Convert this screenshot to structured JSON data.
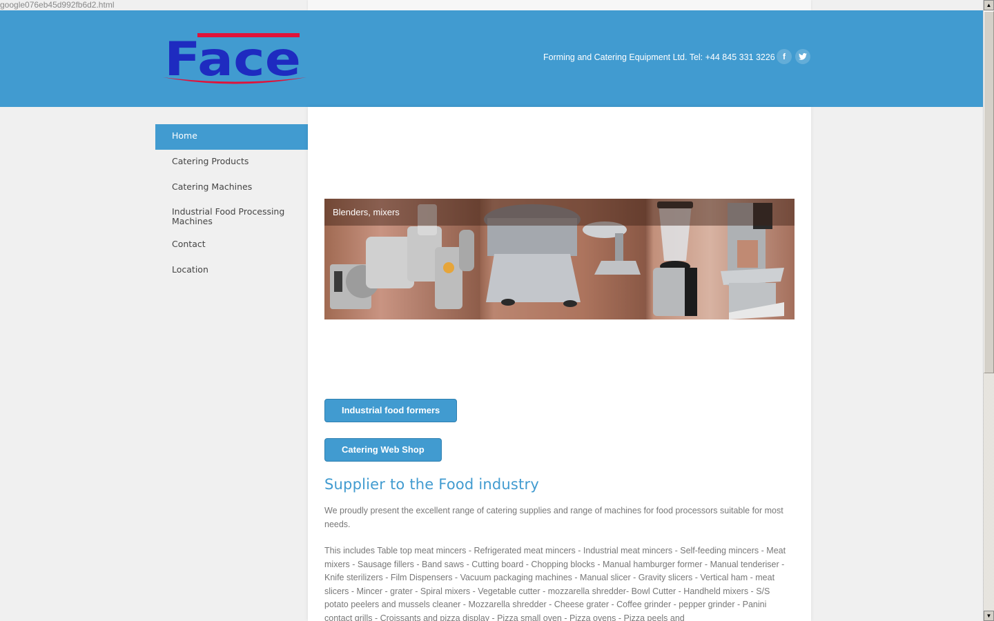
{
  "page_url": "google076eb45d992fb6d2.html",
  "header": {
    "logo_text": "Face",
    "company_info": "Forming and Catering Equipment Ltd. Tel: +44 845 331 3226",
    "social": [
      {
        "name": "facebook",
        "glyph": "f"
      },
      {
        "name": "twitter",
        "glyph": "t"
      }
    ],
    "brand_color": "#419bd0",
    "logo_blue": "#1e2bc0",
    "logo_red": "#e0123a"
  },
  "sidebar": {
    "items": [
      {
        "label": "Home",
        "active": true
      },
      {
        "label": "Catering Products",
        "active": false
      },
      {
        "label": "Catering Machines",
        "active": false
      },
      {
        "label": "Industrial Food Processing Machines",
        "active": false
      },
      {
        "label": "Contact",
        "active": false
      },
      {
        "label": "Location",
        "active": false
      }
    ]
  },
  "slider": {
    "caption": "Blenders, mixers",
    "panels": [
      "food-processors-image",
      "hamburger-former-image",
      "blender-image",
      "band-saw-image"
    ]
  },
  "buttons": {
    "industrial_food_formers": "Industrial food formers",
    "catering_web_shop": "Catering Web Shop"
  },
  "content": {
    "heading": "Supplier to the Food industry",
    "intro": "We proudly present the excellent range of catering supplies and range of machines for food processors suitable for most needs.",
    "includes": "This includes  Table top meat mincers - Refrigerated meat mincers - Industrial meat mincers - Self-feeding mincers - Meat mixers - Sausage fillers - Band saws - Cutting board - Chopping blocks - Manual hamburger former - Manual tenderiser - Knife sterilizers - Film Dispensers - Vacuum packaging machines - Manual slicer - Gravity slicers - Vertical ham - meat slicers - Mincer - grater - Spiral mixers - Vegetable cutter - mozzarella shredder- Bowl Cutter - Handheld mixers - S/S potato peelers and mussels cleaner - Mozzarella shredder - Cheese grater - Coffee grinder - pepper grinder - Panini contact grills - Croissants and pizza display - Pizza small oven - Pizza ovens - Pizza peels and"
  },
  "scrollbar": {
    "up_glyph": "▲",
    "down_glyph": "▼"
  }
}
